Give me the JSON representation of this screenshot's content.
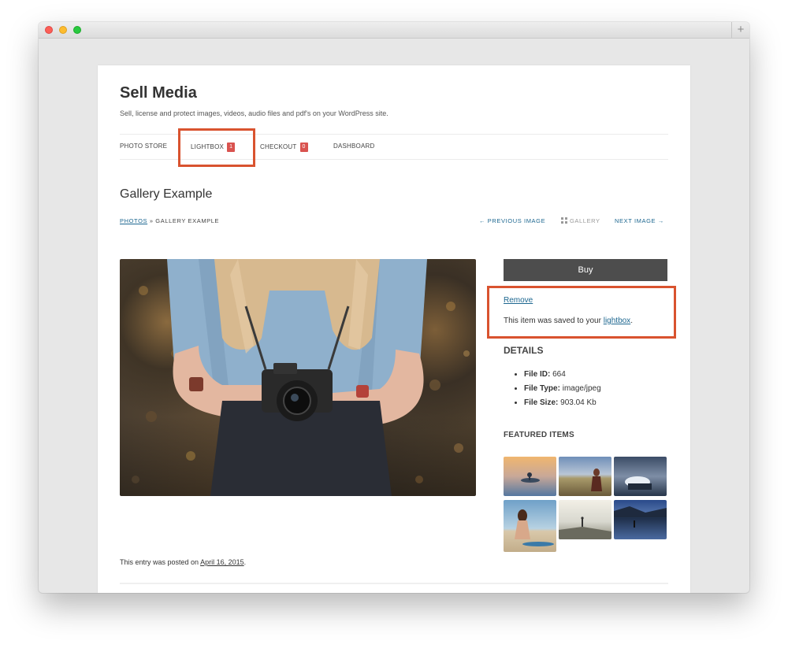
{
  "site": {
    "title": "Sell Media",
    "tagline": "Sell, license and protect images, videos, audio files and pdf's on your WordPress site."
  },
  "nav": {
    "photo_store": "PHOTO STORE",
    "lightbox": "LIGHTBOX",
    "lightbox_count": "1",
    "checkout": "CHECKOUT",
    "checkout_count": "0",
    "dashboard": "DASHBOARD"
  },
  "entry": {
    "title": "Gallery Example"
  },
  "breadcrumb": {
    "parent": "PHOTOS",
    "separator": "»",
    "current": "GALLERY EXAMPLE"
  },
  "image_nav": {
    "previous": "← PREVIOUS IMAGE",
    "gallery": "GALLERY",
    "next": "NEXT IMAGE →"
  },
  "sidebar": {
    "buy_label": "Buy",
    "remove_label": "Remove",
    "saved_prefix": "This item was saved to your ",
    "saved_link": "lightbox",
    "saved_suffix": ".",
    "details_heading": "DETAILS",
    "details": [
      {
        "label": "File ID:",
        "value": "664"
      },
      {
        "label": "File Type:",
        "value": "image/jpeg"
      },
      {
        "label": "File Size:",
        "value": "903.04 Kb"
      }
    ],
    "featured_heading": "FEATURED ITEMS"
  },
  "post": {
    "prefix": "This entry was posted on ",
    "date": "April 16, 2015",
    "suffix": "."
  },
  "colors": {
    "accent_link": "#1d6790",
    "badge": "#d9534f",
    "highlight": "#d9532f",
    "buy_button": "#4d4d4d"
  }
}
